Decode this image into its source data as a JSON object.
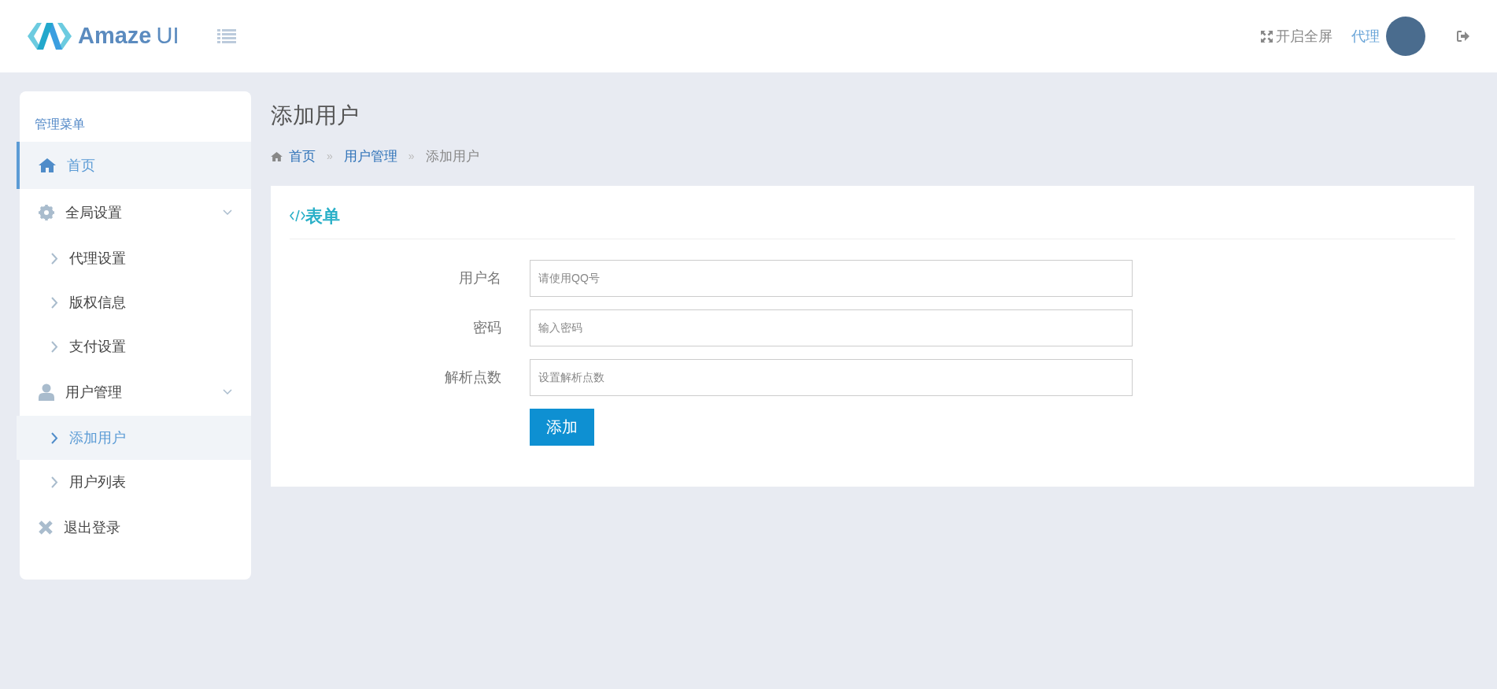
{
  "header": {
    "brand_bold": "Amaze",
    "brand_light": "UI",
    "fullscreen": "开启全屏",
    "username": "代理"
  },
  "sidebar": {
    "title": "管理菜单",
    "items": [
      {
        "label": "首页",
        "selected": true
      },
      {
        "label": "全局设置",
        "selected": false,
        "expanded": true,
        "children": [
          {
            "label": "代理设置",
            "selected": false
          },
          {
            "label": "版权信息",
            "selected": false
          },
          {
            "label": "支付设置",
            "selected": false
          }
        ]
      },
      {
        "label": "用户管理",
        "selected": false,
        "expanded": true,
        "children": [
          {
            "label": "添加用户",
            "selected": true
          },
          {
            "label": "用户列表",
            "selected": false
          }
        ]
      },
      {
        "label": "退出登录",
        "selected": false
      }
    ]
  },
  "page_title": "添加用户",
  "breadcrumb": [
    {
      "label": "首页",
      "current": false
    },
    {
      "label": "用户管理",
      "current": false
    },
    {
      "label": "添加用户",
      "current": true
    }
  ],
  "breadcrumb_separator": "»",
  "form": {
    "title": "表单",
    "fields": [
      {
        "label": "用户名",
        "placeholder": "请使用QQ号"
      },
      {
        "label": "密码",
        "placeholder": "输入密码"
      },
      {
        "label": "解析点数",
        "placeholder": "设置解析点数"
      }
    ],
    "submit": "添加"
  }
}
